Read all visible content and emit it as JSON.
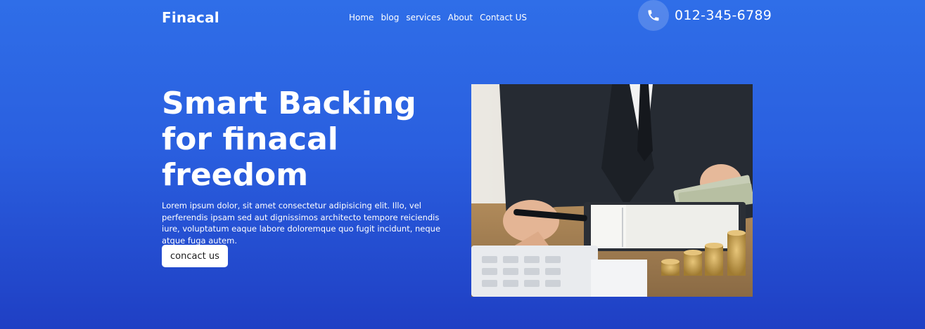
{
  "brand": {
    "name": "Finacal"
  },
  "nav": {
    "items": [
      {
        "label": "Home"
      },
      {
        "label": "blog"
      },
      {
        "label": "services"
      },
      {
        "label": "About"
      },
      {
        "label": "Contact US"
      }
    ]
  },
  "contact": {
    "icon": "phone-icon",
    "phone": "012-345-6789"
  },
  "hero": {
    "title_lines": [
      "Smart Backing",
      "for finacal",
      "freedom"
    ],
    "body": "Lorem ipsum dolor, sit amet consectetur adipisicing elit. Illo, vel perferendis ipsam sed aut dignissimos architecto tempore reiciendis iure, voluptatum eaque labore doloremque quo fugit incidunt, neque atque fuga autem.",
    "cta_label": "concact us"
  },
  "colors": {
    "background_top": "#2f6ee8",
    "background_bottom": "#1f3fc4",
    "text": "#ffffff",
    "button_bg": "#ffffff"
  }
}
